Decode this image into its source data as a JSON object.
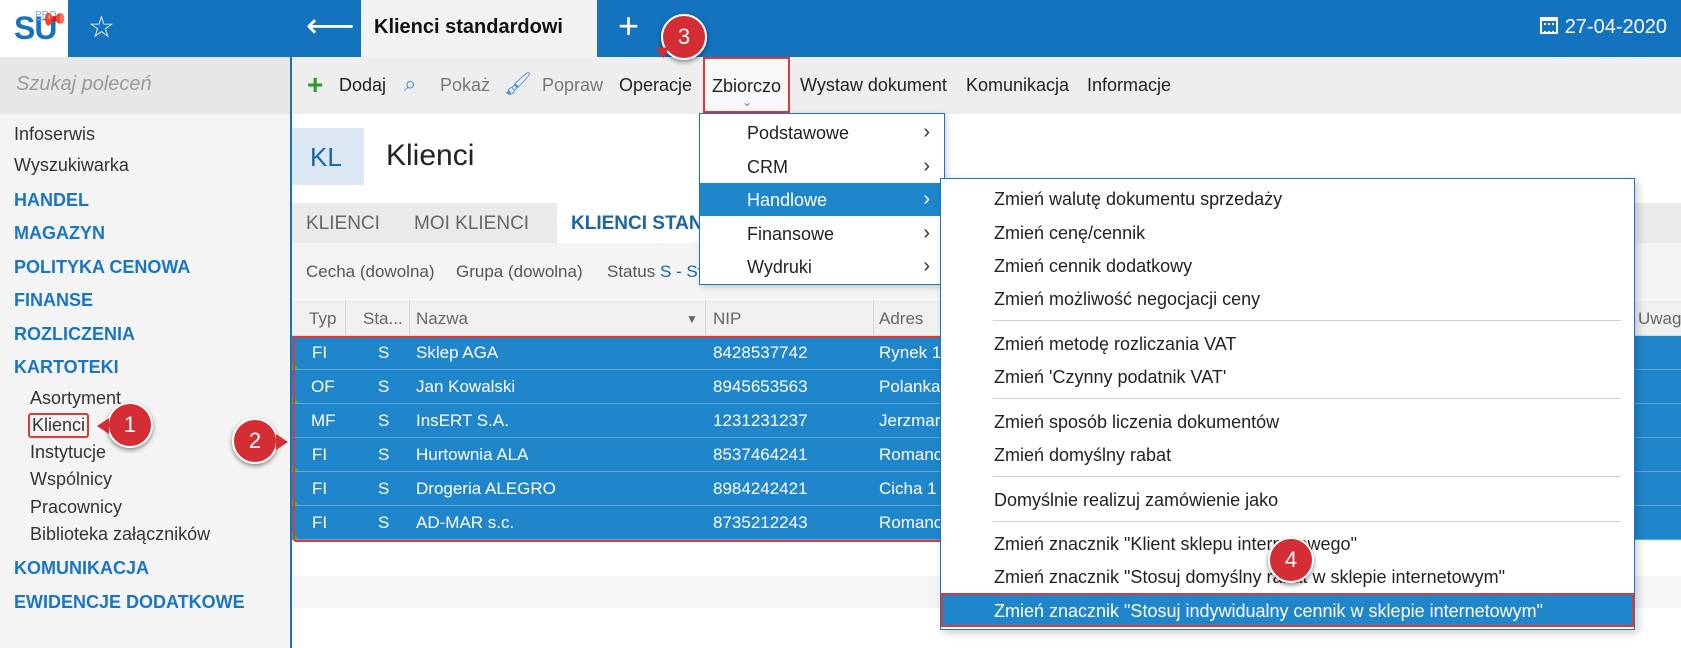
{
  "topbar": {
    "logo": "SU",
    "logo_sup": "PRO",
    "tab_title": "Klienci standardowi",
    "date": "27-04-2020"
  },
  "sidebar": {
    "search_placeholder": "Szukaj poleceń",
    "items": [
      "Infoserwis",
      "Wyszukiwarka"
    ],
    "sections": [
      "HANDEL",
      "MAGAZYN",
      "POLITYKA CENOWA",
      "FINANSE",
      "ROZLICZENIA",
      "KARTOTEKI"
    ],
    "kartoteki_items": [
      "Asortyment",
      "Klienci",
      "Instytucje",
      "Wspólnicy",
      "Pracownicy",
      "Biblioteka załączników"
    ],
    "bottom_sections": [
      "KOMUNIKACJA",
      "EWIDENCJE DODATKOWE"
    ]
  },
  "toolbar": {
    "add": "Dodaj",
    "show": "Pokaż",
    "edit": "Popraw",
    "operations": "Operacje",
    "bulk": "Zbiorczo",
    "issue_doc": "Wystaw dokument",
    "communication": "Komunikacja",
    "info": "Informacje"
  },
  "header": {
    "badge": "KL",
    "title": "Klienci"
  },
  "tabs": {
    "t1": "KLIENCI",
    "t2": "MOI KLIENCI",
    "t3": "KLIENCI STAN"
  },
  "filters": {
    "cecha": "Cecha (dowolna)",
    "grupa": "Grupa (dowolna)",
    "status_label": "Status",
    "status_value": "S - St"
  },
  "grid": {
    "columns": [
      "Typ",
      "Sta...",
      "Nazwa",
      "NIP",
      "Adres",
      "Uwag"
    ],
    "rows": [
      {
        "typ": "FI",
        "status": "S",
        "nazwa": "Sklep AGA",
        "nip": "8428537742",
        "adres": "Rynek 1"
      },
      {
        "typ": "OF",
        "status": "S",
        "nazwa": "Jan Kowalski",
        "nip": "8945653563",
        "adres": "Polanka"
      },
      {
        "typ": "MF",
        "status": "S",
        "nazwa": "InsERT S.A.",
        "nip": "1231231237",
        "adres": "Jerzmar"
      },
      {
        "typ": "FI",
        "status": "S",
        "nazwa": "Hurtownia ALA",
        "nip": "8537464241",
        "adres": "Romanc"
      },
      {
        "typ": "FI",
        "status": "S",
        "nazwa": "Drogeria ALEGRO",
        "nip": "8984242421",
        "adres": "Cicha 1"
      },
      {
        "typ": "FI",
        "status": "S",
        "nazwa": "AD-MAR s.c.",
        "nip": "8735212243",
        "adres": "Romanc"
      }
    ]
  },
  "menu": {
    "items": [
      "Podstawowe",
      "CRM",
      "Handlowe",
      "Finansowe",
      "Wydruki"
    ],
    "submenu_groups": [
      [
        "Zmień walutę dokumentu sprzedaży",
        "Zmień cenę/cennik",
        "Zmień cennik dodatkowy",
        "Zmień możliwość negocjacji ceny"
      ],
      [
        "Zmień metodę rozliczania VAT",
        "Zmień 'Czynny podatnik VAT'"
      ],
      [
        "Zmień sposób liczenia dokumentów",
        "Zmień domyślny rabat"
      ],
      [
        "Domyślnie realizuj zamówienie jako"
      ],
      [
        "Zmień znacznik \"Klient sklepu internetowego\"",
        "Zmień znacznik \"Stosuj domyślny rabat w sklepie internetowym\""
      ]
    ],
    "highlighted": "Zmień znacznik \"Stosuj indywidualny cennik w sklepie internetowym\""
  },
  "callouts": [
    "1",
    "2",
    "3",
    "4"
  ],
  "colors": {
    "brand": "#1373be",
    "selection": "#1f86cc",
    "callout": "#d42e34",
    "section": "#1a75c5"
  }
}
